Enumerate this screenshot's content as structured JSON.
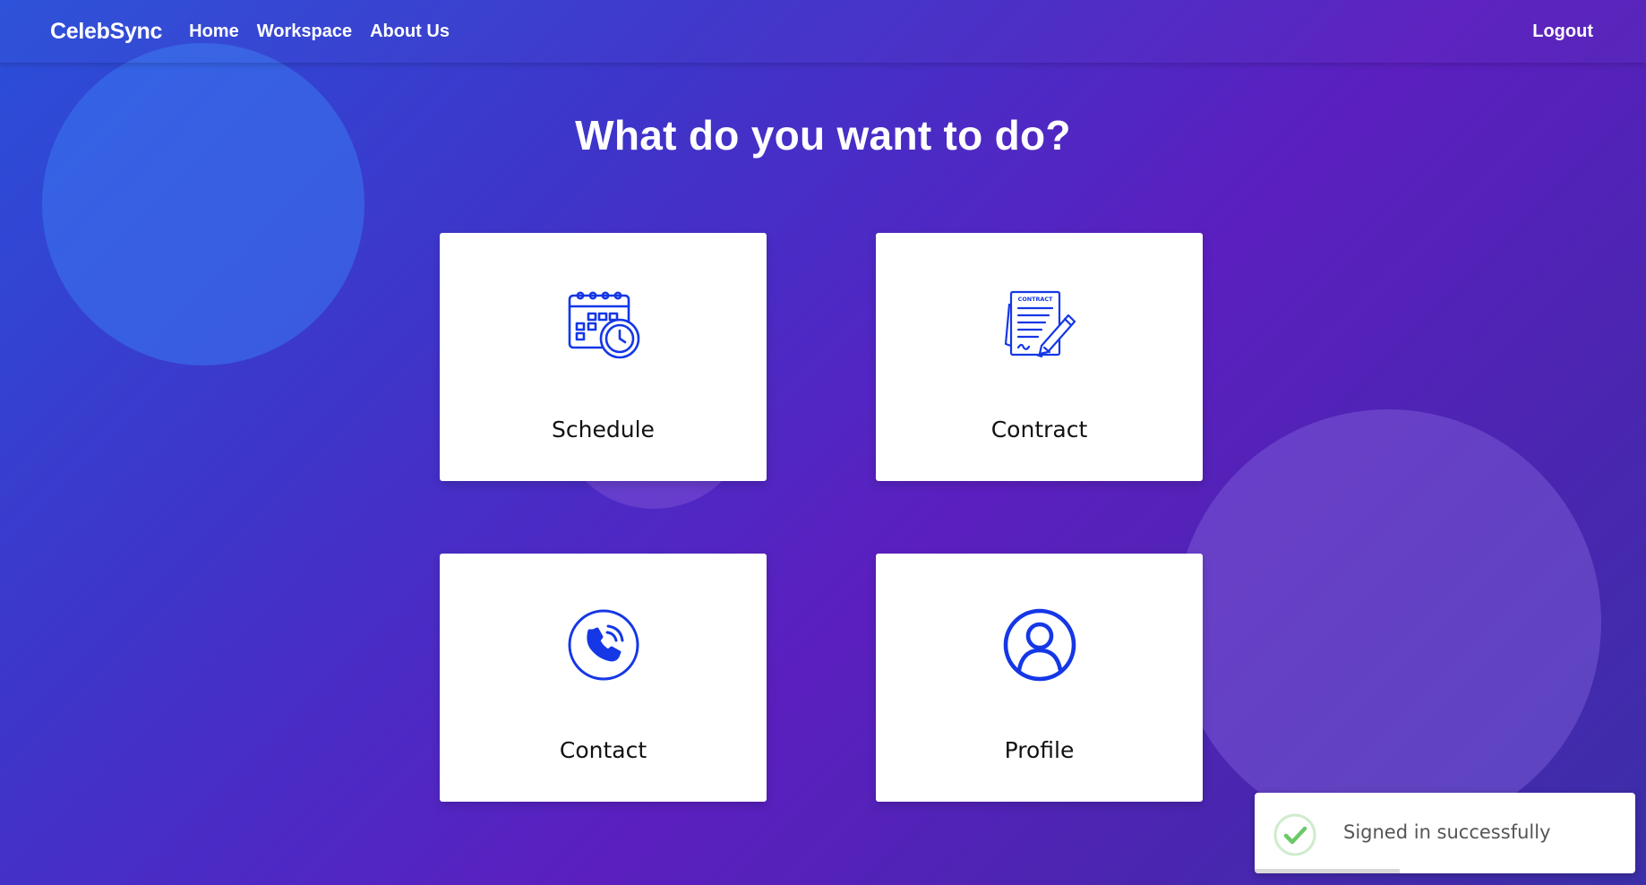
{
  "navbar": {
    "brand": "CelebSync",
    "links": [
      "Home",
      "Workspace",
      "About Us"
    ],
    "logout": "Logout"
  },
  "main": {
    "title": "What do you want to do?",
    "cards": [
      {
        "label": "Schedule",
        "icon": "calendar-clock-icon"
      },
      {
        "label": "Contract",
        "icon": "contract-document-icon"
      },
      {
        "label": "Contact",
        "icon": "phone-call-icon"
      },
      {
        "label": "Profile",
        "icon": "user-profile-icon"
      }
    ]
  },
  "toast": {
    "message": "Signed in successfully",
    "icon": "check-circle-icon",
    "progress_fraction": 0.38
  },
  "colors": {
    "icon_blue": "#1537e6",
    "toast_check": "#7ed07a"
  }
}
